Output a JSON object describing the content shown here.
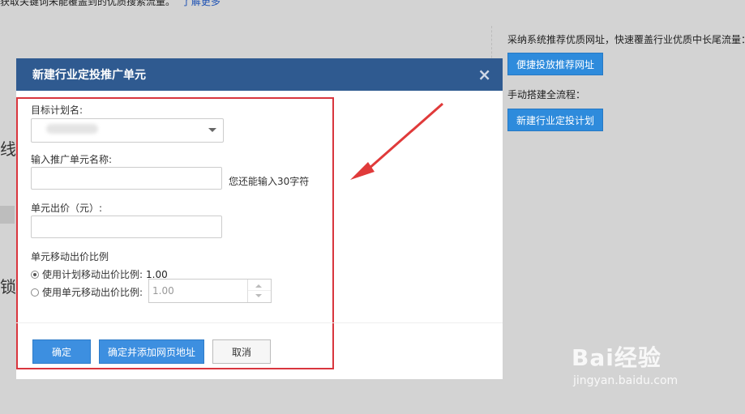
{
  "background": {
    "top_text": "获取关键词未能覆盖到的优质搜索流量。",
    "top_link": "了解更多",
    "partial_char_1": "线",
    "partial_char_2": "锁"
  },
  "right_panel": {
    "label_1": "采纳系统推荐优质网址，快速覆盖行业优质中长尾流量：",
    "button_1": "便捷投放推荐网址",
    "label_2": "手动搭建全流程：",
    "button_2": "新建行业定投计划"
  },
  "dialog": {
    "title": "新建行业定投推广单元",
    "close_glyph": "×",
    "plan_label": "目标计划名:",
    "unit_name_label": "输入推广单元名称:",
    "unit_name_hint": "您还能输入30字符",
    "bid_label": "单元出价（元）:",
    "mobile_ratio_label": "单元移动出价比例",
    "radio_plan_label": "使用计划移动出价比例:",
    "radio_plan_value": "1.00",
    "radio_unit_label": "使用单元移动出价比例:",
    "unit_ratio_value": "1.00",
    "btn_confirm": "确定",
    "btn_confirm_add": "确定并添加网页地址",
    "btn_cancel": "取消"
  },
  "watermark": {
    "brand": "Bai经验",
    "url": "jingyan.baidu.com"
  },
  "colors": {
    "accent": "#2e8bdc",
    "header": "#2f5a90",
    "highlight": "#d9363e"
  }
}
